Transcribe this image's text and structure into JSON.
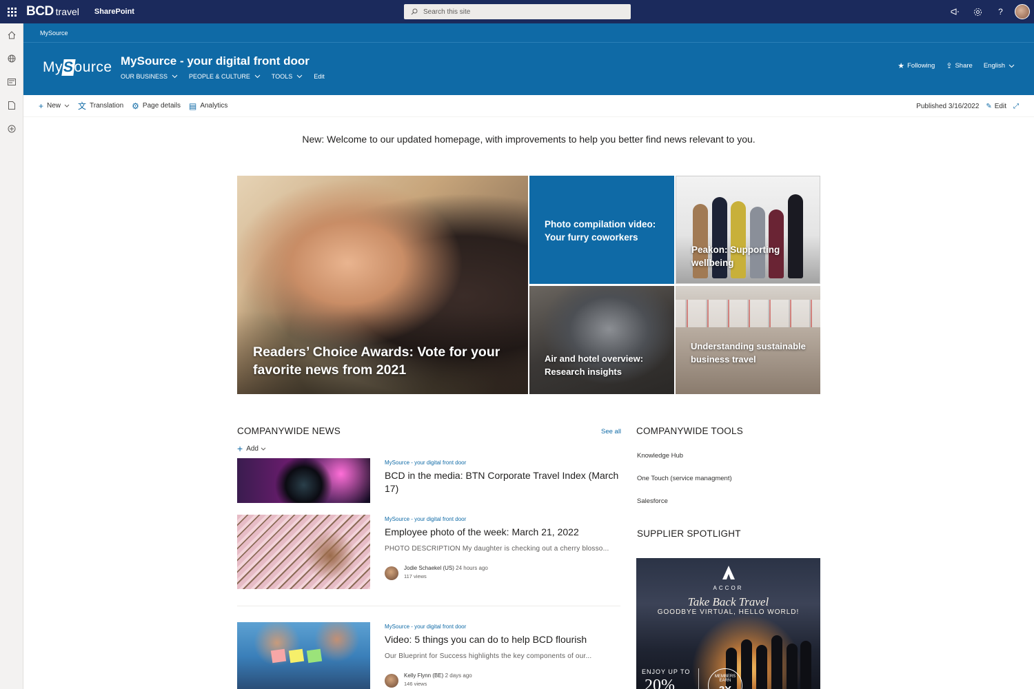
{
  "suitebar": {
    "brand": "BCD",
    "brand_suffix": "travel",
    "app_name": "SharePoint",
    "search_placeholder": "Search this site"
  },
  "hub": {
    "name": "MySource"
  },
  "site": {
    "logo_left": "My",
    "logo_s": "S",
    "logo_right": "ource",
    "title": "MySource - your digital front door",
    "nav": [
      "OUR BUSINESS",
      "PEOPLE & CULTURE",
      "TOOLS",
      "Edit"
    ],
    "actions": {
      "following": "Following",
      "share": "Share",
      "language": "English"
    }
  },
  "commandbar": {
    "new": "New",
    "translation": "Translation",
    "page_details": "Page details",
    "analytics": "Analytics",
    "published": "Published 3/16/2022",
    "edit": "Edit"
  },
  "welcome": "New: Welcome to our updated homepage, with improvements to help you better find news relevant to you.",
  "hero": {
    "main": "Readers’ Choice Awards: Vote for your favorite news from 2021",
    "tile2": "Photo compilation video: Your furry coworkers",
    "tile3": "Peakon: Supporting wellbeing",
    "tile4": "Air and hotel overview: Research insights",
    "tile5": "Understanding sustainable business travel"
  },
  "news": {
    "heading": "COMPANYWIDE NEWS",
    "see_all": "See all",
    "add": "Add",
    "items": [
      {
        "source": "MySource - your digital front door",
        "title": "BCD in the media: BTN Corporate Travel Index (March 17)"
      },
      {
        "source": "MySource - your digital front door",
        "title": "Employee photo of the week: March 21, 2022",
        "desc": "PHOTO DESCRIPTION My daughter is checking out a cherry blosso...",
        "author": "Jodie Schaekel (US)",
        "time": "24 hours ago",
        "views": "117 views"
      },
      {
        "source": "MySource - your digital front door",
        "title": "Video: 5 things you can do to help BCD flourish",
        "desc": "Our Blueprint for Success highlights the key components of our...",
        "author": "Kelly Flynn (BE)",
        "time": "2 days ago",
        "views": "146 views"
      }
    ]
  },
  "tools": {
    "heading": "COMPANYWIDE TOOLS",
    "items": [
      "Knowledge Hub",
      "One Touch (service managment)",
      "Salesforce"
    ]
  },
  "spotlight": {
    "heading": "SUPPLIER SPOTLIGHT",
    "ad": {
      "brand": "ACCOR",
      "tagline": "Take Back Travel",
      "sub": "GOODBYE VIRTUAL, HELLO WORLD!",
      "enjoy": "ENJOY UP TO",
      "percent": "20%",
      "badge_text": "MEMBERS EARN",
      "badge_num": "3X"
    }
  },
  "colors": {
    "suitebar": "#1b2a5c",
    "header": "#0f6aa6",
    "accent": "#0f6aa6"
  }
}
